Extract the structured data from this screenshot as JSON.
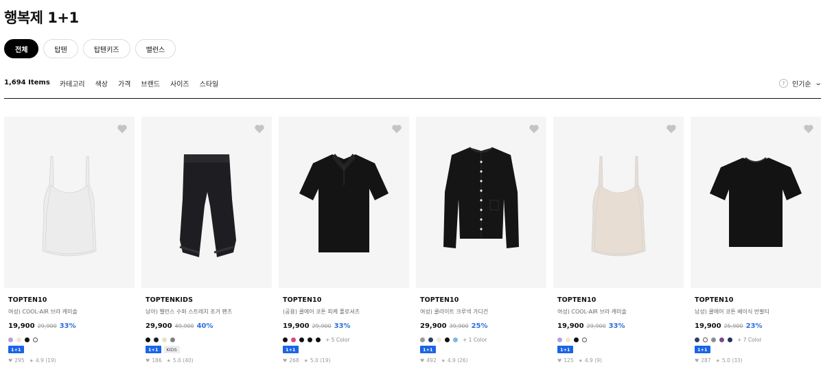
{
  "page": {
    "title": "행복제 1+1"
  },
  "tabs": [
    "전체",
    "탑텐",
    "탑텐키즈",
    "밸런스"
  ],
  "filterbar": {
    "count": "1,694 Items",
    "filters": [
      "카테고리",
      "색상",
      "가격",
      "브랜드",
      "사이즈",
      "스타일"
    ],
    "sort_help": "?",
    "sort_label": "인기순",
    "sort_chevron": "⌄"
  },
  "icons": {
    "heart": "heart-icon",
    "like": "♥",
    "star": "★"
  },
  "colors": {
    "accent": "#1a64e6",
    "discount": "#2b6fe0",
    "active_chip": "#000000"
  },
  "products": [
    {
      "brand": "TOPTEN10",
      "name": "여성) COOL-AIR 브라 캐미솔",
      "price": "19,900",
      "original": "29,900",
      "discount": "33%",
      "swatches": [
        "#b9a0dd",
        "#efe6cf",
        "#111111",
        "outline"
      ],
      "more_colors": "",
      "badges": [
        "1+1"
      ],
      "likes": "295",
      "rating": "4.9 (19)",
      "garment": "cami",
      "garment_color": "#ececec"
    },
    {
      "brand": "TOPTENKIDS",
      "name": "남아) 밸런스 수퍼 스트레치 조거 팬츠",
      "price": "29,900",
      "original": "49,900",
      "discount": "40%",
      "swatches": [
        "#111111",
        "#1b1b2a",
        "#e8e2c8",
        "#7e8084"
      ],
      "more_colors": "",
      "badges": [
        "1+1",
        "KIDS"
      ],
      "likes": "186",
      "rating": "5.0 (40)",
      "garment": "pants",
      "garment_color": "#1e1e22"
    },
    {
      "brand": "TOPTEN10",
      "name": "(공용) 쿨에어 코튼 피케 폴로셔츠",
      "price": "19,900",
      "original": "29,900",
      "discount": "33%",
      "swatches": [
        "#111111",
        "#e0457b",
        "#111111",
        "#111111",
        "#111111"
      ],
      "more_colors": "+ 5 Color",
      "badges": [
        "1+1"
      ],
      "likes": "268",
      "rating": "5.0 (19)",
      "garment": "polo",
      "garment_color": "#141414"
    },
    {
      "brand": "TOPTEN10",
      "name": "여성) 쿨라이트 크루넥 가디건",
      "price": "29,900",
      "original": "39,900",
      "discount": "25%",
      "swatches": [
        "#9a9a9a",
        "#2c3f66",
        "#f0ead9",
        "#111111",
        "#7fb6e6"
      ],
      "more_colors": "+ 1 Color",
      "badges": [
        "1+1"
      ],
      "likes": "492",
      "rating": "4.9 (26)",
      "garment": "cardigan",
      "garment_color": "#151515"
    },
    {
      "brand": "TOPTEN10",
      "name": "여성) COOL-AIR 브라 캐미솔",
      "price": "19,900",
      "original": "29,900",
      "discount": "33%",
      "swatches": [
        "#b9a0dd",
        "#efe6cf",
        "#111111",
        "outline"
      ],
      "more_colors": "",
      "badges": [
        "1+1"
      ],
      "likes": "125",
      "rating": "4.9 (9)",
      "garment": "cami",
      "garment_color": "#e7ddd3"
    },
    {
      "brand": "TOPTEN10",
      "name": "남성) 쿨에어 코튼 베이식 반팔티",
      "price": "19,900",
      "original": "25,900",
      "discount": "23%",
      "swatches": [
        "#2c3f66",
        "outline",
        "#8e8e8e",
        "#7a4a86",
        "#23335c"
      ],
      "more_colors": "+ 7 Color",
      "badges": [
        "1+1"
      ],
      "likes": "287",
      "rating": "5.0 (33)",
      "garment": "tee",
      "garment_color": "#131313"
    }
  ]
}
